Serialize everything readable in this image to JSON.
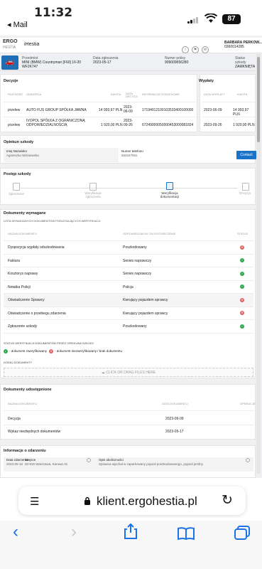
{
  "status_bar": {
    "time": "11:32",
    "back_label": "◂ Mail",
    "battery": "87"
  },
  "header": {
    "logo_main": "ERGO",
    "logo_sub": "HESTIA",
    "app_title": "iHestia",
    "user_name": "BARBARA PERKOW...",
    "user_id": "0360014285"
  },
  "claim": {
    "subject_label": "Przedmiot",
    "subject_value1": "MINI (BMW) Countryman [F60] 16-20",
    "subject_value2": "WF2K747",
    "date_label": "Data zgłoszenia",
    "date_value": "2023-05-17",
    "policy_label": "Numer polisy",
    "policy_value": "909009656280",
    "status_label": "Status szkody",
    "status_value": "ZAMKNIĘTA"
  },
  "decisions": {
    "title": "Decyzje",
    "headers": [
      "PŁATNOŚĆ",
      "ODBIORCA",
      "KWOTA",
      "DATA DECYZJI",
      "INFORMACJE DODATKOWE"
    ],
    "rows": [
      {
        "payment": "przelew",
        "recipient": "AUTO FUS GROUP SPÓŁKA JAWNA",
        "amount": "14 993,97 PLN",
        "date": "2023-06-09",
        "info": "17194012100103533400100000"
      },
      {
        "payment": "przelew",
        "recipient": "IVOPOL SPÓŁKA Z OGRANICZONĄ ODPOWIEDZIALNOŚCIĄ",
        "amount": "1 920,00 PLN",
        "date": "2023-09-26",
        "info": "67249000050000453000081824"
      }
    ]
  },
  "payouts": {
    "title": "Wypłaty",
    "headers": [
      "DATA WYPŁATY",
      "KWOTA"
    ],
    "rows": [
      {
        "date": "2023-06-09",
        "amount": "14 993,97 PLN"
      },
      {
        "date": "2023-09-26",
        "amount": "1 920,00 PLN"
      }
    ]
  },
  "handler": {
    "title": "Opiekun szkody",
    "name_label": "Imię Nazwisko",
    "name_value": "Agnieszka Wiśniewska",
    "phone_label": "Numer telefonu",
    "phone_value": "583347591",
    "contact_button": "Contact"
  },
  "progress": {
    "title": "Postęp szkody",
    "steps": [
      {
        "label": "Zgłoszenie"
      },
      {
        "label": "Weryfikacja zgłoszenia"
      },
      {
        "label": "Weryfikacja dokumentacji"
      },
      {
        "label": "Decyzja"
      }
    ]
  },
  "documents_required": {
    "title": "Dokumenty wymagane",
    "subtitle": "LISTA WYMAGANYCH DOKUMENTÓW PODLEGAJĄCYCH WERYFIKACJI",
    "headers": [
      "NAZWA DOKUMENTU",
      "ODPOWIEDZIALNY ZA DOSTARCZENIE",
      "STATUS"
    ],
    "rows": [
      {
        "name": "Dyspozycja wypłaty odszkodowania",
        "responsible": "Poszkodowany",
        "status": "no"
      },
      {
        "name": "Faktura",
        "responsible": "Serwis naprawczy",
        "status": "ok"
      },
      {
        "name": "Kosztorys naprawy",
        "responsible": "Serwis naprawczy",
        "status": "ok"
      },
      {
        "name": "Notatka Policji",
        "responsible": "Policja",
        "status": "ok"
      },
      {
        "name": "Oświadczenie Sprawcy",
        "responsible": "Kierujący pojazdem sprawcy",
        "status": "no"
      },
      {
        "name": "Oświadczenie o przebiegu zdarzenia",
        "responsible": "Kierujący pojazdem sprawcy",
        "status": "no"
      },
      {
        "name": "Zgłoszenie szkody",
        "responsible": "Poszkodowany",
        "status": "ok"
      }
    ],
    "legend_title": "STATUS WERYFIKACJI DOKUMENTÓW PRZEZ OPIEKUNA SZKODY",
    "legend_ok": "- dokument zweryfikowany",
    "legend_no": "- dokument niezweryfikowany / brak dokumentu",
    "add_title": "DODAJ DOKUMENTY",
    "upload_text": "CLICK OR DRAG FILES HERE"
  },
  "documents_shared": {
    "title": "Dokumenty udostępnione",
    "headers": [
      "NAZWA DOKUMENTU",
      "DATA DOKUMENTU",
      "OPERACJE"
    ],
    "rows": [
      {
        "name": "Decyzja",
        "date": "2023-06-09"
      },
      {
        "name": "Wykaz niezbędnych dokumentów",
        "date": "2023-05-17"
      }
    ]
  },
  "event": {
    "title": "Informacje o zdarzeniu",
    "date_label": "Data zdarzenia",
    "date_value": "2023-05-16",
    "place_label": "Miejsce",
    "place_value": "00-915 Warszawa, Karowa 31",
    "desc_label": "Opis okoliczności",
    "desc_value": "Sprawca wjechał w zaparkowany pojazd poszkodowanego, pojazd jezdny"
  },
  "browser": {
    "url": "klient.ergohestia.pl"
  }
}
